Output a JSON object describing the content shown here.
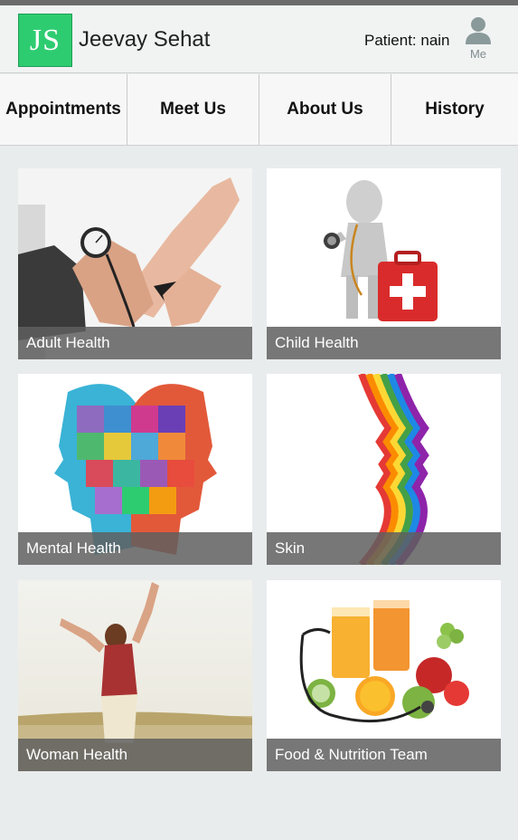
{
  "app": {
    "logo_text": "JS",
    "title": "Jeevay Sehat",
    "patient_label": "Patient: nain",
    "me_label": "Me",
    "me_icon": "user-icon"
  },
  "tabs": [
    "Appointments",
    "Meet Us",
    "About Us",
    "History"
  ],
  "tiles": [
    {
      "label": "Adult Health",
      "image": "blood-pressure-measurement"
    },
    {
      "label": "Child Health",
      "image": "figure-with-stethoscope-and-first-aid-kit"
    },
    {
      "label": "Mental Health",
      "image": "puzzle-heads"
    },
    {
      "label": "Skin",
      "image": "rainbow-face-profile"
    },
    {
      "label": "Woman Health",
      "image": "woman-in-field"
    },
    {
      "label": "Food & Nutrition Team",
      "image": "juice-fruits-stethoscope"
    }
  ],
  "colors": {
    "logo_green": "#2ecc71",
    "background": "#e9ecec",
    "caption_overlay": "#5f5f5f"
  }
}
